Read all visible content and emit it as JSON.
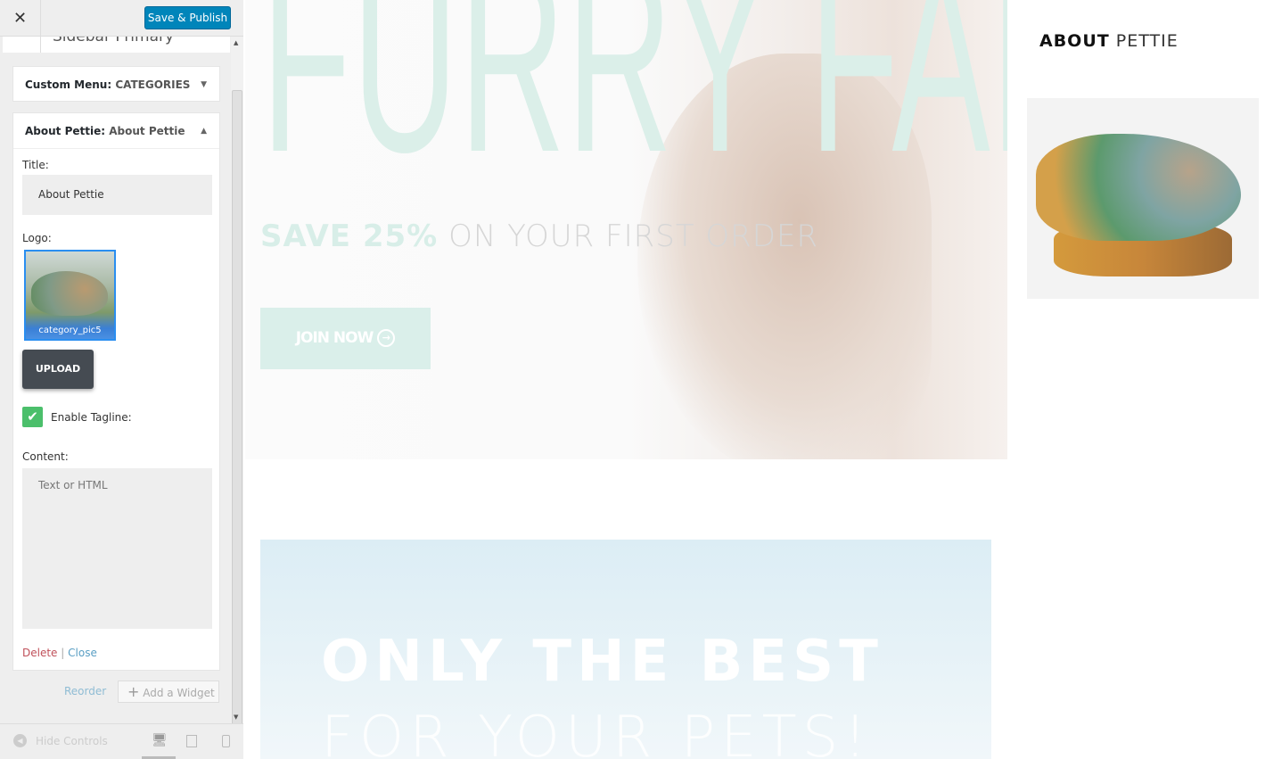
{
  "customizer": {
    "close_icon": "close-icon",
    "save_publish": "Save & Publish",
    "section_peek": "Sidebar Primary",
    "widgets": [
      {
        "type": "Custom Menu:",
        "name": "CATEGORIES",
        "state": "collapsed"
      },
      {
        "type": "About Pettie:",
        "name": "About Pettie",
        "state": "expanded"
      }
    ],
    "form": {
      "title_label": "Title:",
      "title_value": "About Pettie",
      "logo_label": "Logo:",
      "logo_filename": "category_pic5",
      "upload_label": "UPLOAD",
      "tagline_label": "Enable Tagline:",
      "tagline_checked": true,
      "content_label": "Content:",
      "content_placeholder": "Text or HTML",
      "delete": "Delete",
      "separator": "|",
      "close": "Close"
    },
    "reorder": "Reorder",
    "add_widget": "Add a Widget",
    "hide_controls": "Hide Controls",
    "devices": [
      "desktop",
      "tablet",
      "mobile"
    ],
    "active_device": "desktop",
    "colors": {
      "primary": "#0085ba",
      "delete": "#a00",
      "link": "#0073aa",
      "check": "#4bbf6b"
    }
  },
  "preview": {
    "hero_title": "FURRY FAMILY",
    "promo_bold": "SAVE 25%",
    "promo_rest": "ON YOUR FIRST ORDER",
    "join_button": "JOIN NOW",
    "banner_title": "ONLY THE BEST",
    "banner_sub": "FOR YOUR PETS!",
    "sidebar_title_bold": "ABOUT",
    "sidebar_title_rest": "PETTIE"
  }
}
